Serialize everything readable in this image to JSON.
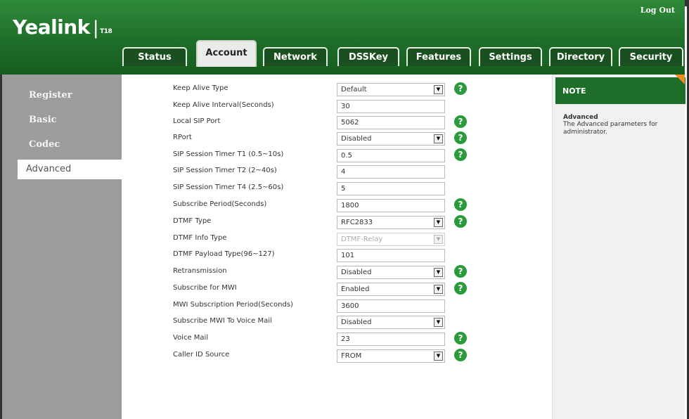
{
  "header": {
    "logo": "Yealink",
    "logo_sep": "|",
    "model": "T18",
    "logout": "Log Out"
  },
  "tabs": [
    {
      "label": "Status"
    },
    {
      "label": "Account"
    },
    {
      "label": "Network"
    },
    {
      "label": "DSSKey"
    },
    {
      "label": "Features"
    },
    {
      "label": "Settings"
    },
    {
      "label": "Directory"
    },
    {
      "label": "Security"
    }
  ],
  "active_tab": "Account",
  "sidebar": {
    "items": [
      {
        "label": "Register"
      },
      {
        "label": "Basic"
      },
      {
        "label": "Codec"
      },
      {
        "label": "Advanced"
      }
    ],
    "active": "Advanced"
  },
  "rows": [
    {
      "label": "Keep Alive Type",
      "value": "Default",
      "type": "select",
      "help": true
    },
    {
      "label": "Keep Alive Interval(Seconds)",
      "value": "30",
      "type": "input",
      "help": false
    },
    {
      "label": "Local SIP Port",
      "value": "5062",
      "type": "input",
      "help": true
    },
    {
      "label": "RPort",
      "value": "Disabled",
      "type": "select",
      "help": true
    },
    {
      "label": "SIP Session Timer T1 (0.5~10s)",
      "value": "0.5",
      "type": "input",
      "help": true
    },
    {
      "label": "SIP Session Timer T2 (2~40s)",
      "value": "4",
      "type": "input",
      "help": false
    },
    {
      "label": "SIP Session Timer T4 (2.5~60s)",
      "value": "5",
      "type": "input",
      "help": false
    },
    {
      "label": "Subscribe Period(Seconds)",
      "value": "1800",
      "type": "input",
      "help": true
    },
    {
      "label": "DTMF Type",
      "value": "RFC2833",
      "type": "select",
      "help": true
    },
    {
      "label": "DTMF Info Type",
      "value": "DTMF-Relay",
      "type": "select-disabled",
      "help": false
    },
    {
      "label": "DTMF Payload Type(96~127)",
      "value": "101",
      "type": "input",
      "help": false
    },
    {
      "label": "Retransmission",
      "value": "Disabled",
      "type": "select",
      "help": true
    },
    {
      "label": "Subscribe for MWI",
      "value": "Enabled",
      "type": "select",
      "help": true
    },
    {
      "label": "MWI Subscription Period(Seconds)",
      "value": "3600",
      "type": "input",
      "help": false
    },
    {
      "label": "Subscribe MWI To Voice Mail",
      "value": "Disabled",
      "type": "select",
      "help": false
    },
    {
      "label": "Voice Mail",
      "value": "23",
      "type": "input",
      "help": true
    },
    {
      "label": "Caller ID Source",
      "value": "FROM",
      "type": "select",
      "help": true
    }
  ],
  "note": {
    "heading": "NOTE",
    "title": "Advanced",
    "text": "The Advanced parameters for administrator."
  },
  "icons": {
    "help": "question-mark-circle-icon",
    "dropdown": "dropdown-arrow-icon"
  },
  "colors": {
    "header_green": "#1f6e29",
    "help_green": "#2a9a3c",
    "sidebar_gray": "#9c9c9c",
    "note_corner": "#f08a23"
  }
}
